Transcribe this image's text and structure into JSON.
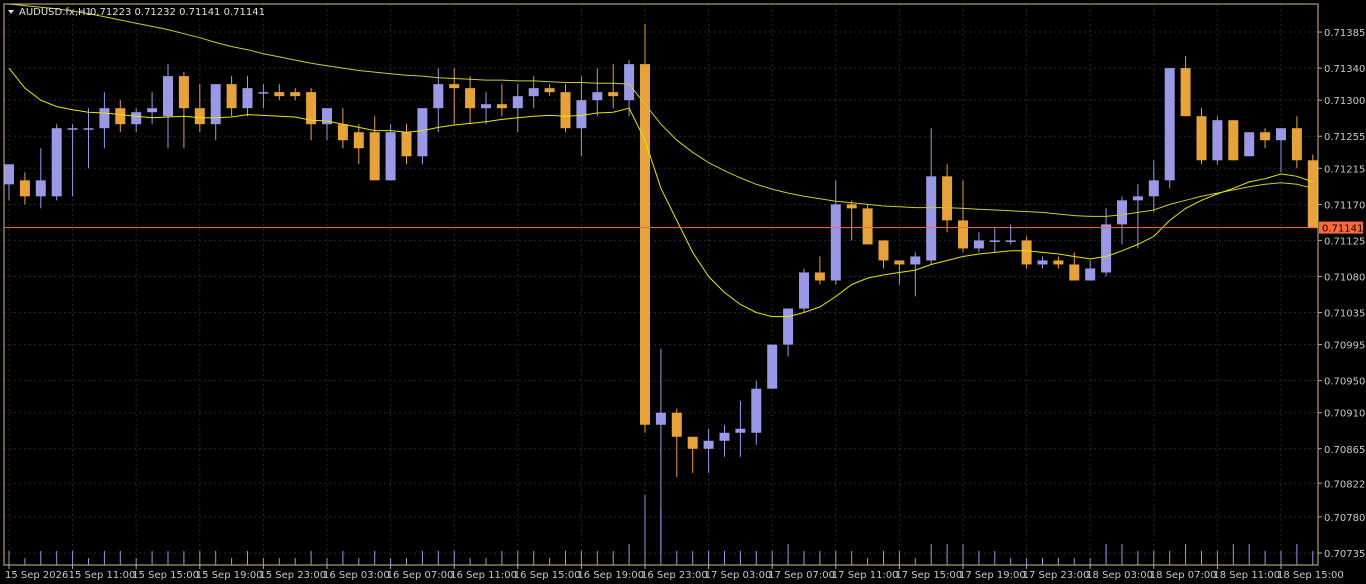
{
  "header": {
    "symbol": "AUDUSD.fx,H1",
    "ohlc": "0.71223 0.71232 0.71141 0.71141"
  },
  "price_tag": "0.71141",
  "colors": {
    "background": "#000000",
    "grid": "#2a2a2a",
    "bull": "#9999e6",
    "bear": "#e6a23c",
    "ma_fast": "#e6e600",
    "ma_slow": "#cccc33",
    "price_line": "#ff6a3d",
    "axis_text": "#c8c8c8"
  },
  "chart_data": {
    "type": "candlestick",
    "ylim": [
      0.7072,
      0.7142
    ],
    "grid": true,
    "y_ticks": [
      "0.71385",
      "0.71340",
      "0.71300",
      "0.71255",
      "0.71215",
      "0.71170",
      "0.71125",
      "0.71080",
      "0.71035",
      "0.70995",
      "0.70950",
      "0.70910",
      "0.70865",
      "0.70822",
      "0.70780",
      "0.70735"
    ],
    "x_ticks": [
      "15 Sep 2026",
      "15 Sep 11:00",
      "15 Sep 15:00",
      "15 Sep 19:00",
      "15 Sep 23:00",
      "16 Sep 03:00",
      "16 Sep 07:00",
      "16 Sep 11:00",
      "16 Sep 15:00",
      "16 Sep 19:00",
      "16 Sep 23:00",
      "17 Sep 03:00",
      "17 Sep 07:00",
      "17 Sep 11:00",
      "17 Sep 15:00",
      "17 Sep 19:00",
      "17 Sep 23:00",
      "18 Sep 03:00",
      "18 Sep 07:00",
      "18 Sep 11:00",
      "18 Sep 15:00"
    ],
    "current_price": 0.71141,
    "candles": [
      {
        "o": 0.71195,
        "h": 0.7122,
        "l": 0.71175,
        "c": 0.7122
      },
      {
        "o": 0.712,
        "h": 0.7121,
        "l": 0.7117,
        "c": 0.7118
      },
      {
        "o": 0.7118,
        "h": 0.7124,
        "l": 0.71165,
        "c": 0.712
      },
      {
        "o": 0.7118,
        "h": 0.7127,
        "l": 0.71175,
        "c": 0.71265
      },
      {
        "o": 0.71265,
        "h": 0.7127,
        "l": 0.7118,
        "c": 0.71265
      },
      {
        "o": 0.71265,
        "h": 0.7129,
        "l": 0.71215,
        "c": 0.71265
      },
      {
        "o": 0.71265,
        "h": 0.7131,
        "l": 0.7124,
        "c": 0.7129
      },
      {
        "o": 0.7129,
        "h": 0.713,
        "l": 0.7126,
        "c": 0.7127
      },
      {
        "o": 0.7127,
        "h": 0.7129,
        "l": 0.7126,
        "c": 0.71285
      },
      {
        "o": 0.71285,
        "h": 0.7131,
        "l": 0.7127,
        "c": 0.7129
      },
      {
        "o": 0.7128,
        "h": 0.71345,
        "l": 0.7124,
        "c": 0.7133
      },
      {
        "o": 0.7133,
        "h": 0.71335,
        "l": 0.7124,
        "c": 0.7129
      },
      {
        "o": 0.7129,
        "h": 0.7132,
        "l": 0.7126,
        "c": 0.7127
      },
      {
        "o": 0.7127,
        "h": 0.7132,
        "l": 0.7125,
        "c": 0.7132
      },
      {
        "o": 0.7132,
        "h": 0.7133,
        "l": 0.7128,
        "c": 0.7129
      },
      {
        "o": 0.7129,
        "h": 0.7133,
        "l": 0.7128,
        "c": 0.71315
      },
      {
        "o": 0.7131,
        "h": 0.7132,
        "l": 0.7129,
        "c": 0.7131
      },
      {
        "o": 0.7131,
        "h": 0.7132,
        "l": 0.713,
        "c": 0.71305
      },
      {
        "o": 0.7131,
        "h": 0.71315,
        "l": 0.713,
        "c": 0.71305
      },
      {
        "o": 0.7131,
        "h": 0.71315,
        "l": 0.7125,
        "c": 0.7127
      },
      {
        "o": 0.7127,
        "h": 0.7129,
        "l": 0.7125,
        "c": 0.7129
      },
      {
        "o": 0.7127,
        "h": 0.7129,
        "l": 0.7124,
        "c": 0.7125
      },
      {
        "o": 0.7126,
        "h": 0.7127,
        "l": 0.7122,
        "c": 0.7124
      },
      {
        "o": 0.7126,
        "h": 0.7128,
        "l": 0.712,
        "c": 0.712
      },
      {
        "o": 0.712,
        "h": 0.7127,
        "l": 0.712,
        "c": 0.7126
      },
      {
        "o": 0.7126,
        "h": 0.7127,
        "l": 0.7122,
        "c": 0.7123
      },
      {
        "o": 0.7123,
        "h": 0.7128,
        "l": 0.7122,
        "c": 0.7129
      },
      {
        "o": 0.7129,
        "h": 0.7134,
        "l": 0.7126,
        "c": 0.7132
      },
      {
        "o": 0.7132,
        "h": 0.7134,
        "l": 0.7127,
        "c": 0.71315
      },
      {
        "o": 0.71315,
        "h": 0.7133,
        "l": 0.7127,
        "c": 0.7129
      },
      {
        "o": 0.7129,
        "h": 0.7131,
        "l": 0.7127,
        "c": 0.71295
      },
      {
        "o": 0.71295,
        "h": 0.7132,
        "l": 0.7128,
        "c": 0.7129
      },
      {
        "o": 0.7129,
        "h": 0.7132,
        "l": 0.7126,
        "c": 0.71305
      },
      {
        "o": 0.71305,
        "h": 0.7133,
        "l": 0.7129,
        "c": 0.71315
      },
      {
        "o": 0.71315,
        "h": 0.7132,
        "l": 0.71305,
        "c": 0.7131
      },
      {
        "o": 0.7131,
        "h": 0.7132,
        "l": 0.7126,
        "c": 0.71265
      },
      {
        "o": 0.71265,
        "h": 0.7133,
        "l": 0.7123,
        "c": 0.713
      },
      {
        "o": 0.713,
        "h": 0.7134,
        "l": 0.7128,
        "c": 0.7131
      },
      {
        "o": 0.7131,
        "h": 0.71345,
        "l": 0.7129,
        "c": 0.71305
      },
      {
        "o": 0.713,
        "h": 0.7135,
        "l": 0.7128,
        "c": 0.71345
      },
      {
        "o": 0.71345,
        "h": 0.71395,
        "l": 0.70885,
        "c": 0.70895
      },
      {
        "o": 0.70895,
        "h": 0.7099,
        "l": 0.70735,
        "c": 0.7091
      },
      {
        "o": 0.7091,
        "h": 0.70915,
        "l": 0.7083,
        "c": 0.7088
      },
      {
        "o": 0.7088,
        "h": 0.7088,
        "l": 0.70835,
        "c": 0.70865
      },
      {
        "o": 0.70865,
        "h": 0.7089,
        "l": 0.70835,
        "c": 0.70875
      },
      {
        "o": 0.70875,
        "h": 0.70895,
        "l": 0.70855,
        "c": 0.70885
      },
      {
        "o": 0.70885,
        "h": 0.70925,
        "l": 0.70855,
        "c": 0.7089
      },
      {
        "o": 0.70885,
        "h": 0.7095,
        "l": 0.7087,
        "c": 0.7094
      },
      {
        "o": 0.7094,
        "h": 0.7099,
        "l": 0.7094,
        "c": 0.70995
      },
      {
        "o": 0.70995,
        "h": 0.7104,
        "l": 0.7098,
        "c": 0.7104
      },
      {
        "o": 0.7104,
        "h": 0.7109,
        "l": 0.71035,
        "c": 0.71085
      },
      {
        "o": 0.71085,
        "h": 0.71105,
        "l": 0.7107,
        "c": 0.71075
      },
      {
        "o": 0.71075,
        "h": 0.712,
        "l": 0.7107,
        "c": 0.7117
      },
      {
        "o": 0.7117,
        "h": 0.71175,
        "l": 0.71125,
        "c": 0.71165
      },
      {
        "o": 0.71165,
        "h": 0.7117,
        "l": 0.7112,
        "c": 0.7112
      },
      {
        "o": 0.71125,
        "h": 0.71125,
        "l": 0.7109,
        "c": 0.711
      },
      {
        "o": 0.711,
        "h": 0.711,
        "l": 0.7107,
        "c": 0.71095
      },
      {
        "o": 0.71095,
        "h": 0.7111,
        "l": 0.71055,
        "c": 0.71105
      },
      {
        "o": 0.711,
        "h": 0.71265,
        "l": 0.71095,
        "c": 0.71205
      },
      {
        "o": 0.71205,
        "h": 0.7122,
        "l": 0.71135,
        "c": 0.7115
      },
      {
        "o": 0.7115,
        "h": 0.712,
        "l": 0.7111,
        "c": 0.71115
      },
      {
        "o": 0.71115,
        "h": 0.71135,
        "l": 0.7111,
        "c": 0.71125
      },
      {
        "o": 0.71125,
        "h": 0.7114,
        "l": 0.7111,
        "c": 0.71125
      },
      {
        "o": 0.71125,
        "h": 0.71145,
        "l": 0.7112,
        "c": 0.71125
      },
      {
        "o": 0.71125,
        "h": 0.7113,
        "l": 0.7109,
        "c": 0.71095
      },
      {
        "o": 0.71095,
        "h": 0.71105,
        "l": 0.7109,
        "c": 0.711
      },
      {
        "o": 0.711,
        "h": 0.71105,
        "l": 0.7109,
        "c": 0.71095
      },
      {
        "o": 0.71095,
        "h": 0.7111,
        "l": 0.71075,
        "c": 0.71075
      },
      {
        "o": 0.71075,
        "h": 0.711,
        "l": 0.71075,
        "c": 0.7109
      },
      {
        "o": 0.71085,
        "h": 0.71165,
        "l": 0.7108,
        "c": 0.71145
      },
      {
        "o": 0.71145,
        "h": 0.7118,
        "l": 0.7112,
        "c": 0.71175
      },
      {
        "o": 0.71175,
        "h": 0.71195,
        "l": 0.71115,
        "c": 0.7118
      },
      {
        "o": 0.7118,
        "h": 0.71225,
        "l": 0.7116,
        "c": 0.712
      },
      {
        "o": 0.712,
        "h": 0.7134,
        "l": 0.7119,
        "c": 0.7134
      },
      {
        "o": 0.7134,
        "h": 0.71355,
        "l": 0.7128,
        "c": 0.7128
      },
      {
        "o": 0.7128,
        "h": 0.7129,
        "l": 0.7122,
        "c": 0.71225
      },
      {
        "o": 0.71225,
        "h": 0.7128,
        "l": 0.7122,
        "c": 0.71275
      },
      {
        "o": 0.71275,
        "h": 0.71275,
        "l": 0.71225,
        "c": 0.71225
      },
      {
        "o": 0.7123,
        "h": 0.7126,
        "l": 0.7123,
        "c": 0.7126
      },
      {
        "o": 0.7126,
        "h": 0.71265,
        "l": 0.7124,
        "c": 0.7125
      },
      {
        "o": 0.7125,
        "h": 0.71265,
        "l": 0.7121,
        "c": 0.71265
      },
      {
        "o": 0.71265,
        "h": 0.7128,
        "l": 0.71215,
        "c": 0.71225
      },
      {
        "o": 0.71225,
        "h": 0.71232,
        "l": 0.71141,
        "c": 0.71141
      }
    ],
    "ma_fast": [
      0.7134,
      0.71315,
      0.713,
      0.71292,
      0.71288,
      0.71285,
      0.71284,
      0.71282,
      0.7128,
      0.71278,
      0.71279,
      0.7128,
      0.71278,
      0.71278,
      0.71279,
      0.71282,
      0.71281,
      0.7128,
      0.71279,
      0.71275,
      0.71274,
      0.7127,
      0.71266,
      0.71262,
      0.71262,
      0.7126,
      0.71262,
      0.71266,
      0.71269,
      0.71271,
      0.71273,
      0.71276,
      0.71278,
      0.7128,
      0.71281,
      0.7128,
      0.71281,
      0.71284,
      0.71285,
      0.7129,
      0.7125,
      0.7119,
      0.7115,
      0.7111,
      0.7108,
      0.7106,
      0.71045,
      0.71035,
      0.7103,
      0.7103,
      0.71035,
      0.71042,
      0.71055,
      0.7107,
      0.71078,
      0.71082,
      0.71085,
      0.71088,
      0.71095,
      0.711,
      0.71105,
      0.71108,
      0.7111,
      0.71112,
      0.71112,
      0.7111,
      0.71108,
      0.71105,
      0.71102,
      0.71105,
      0.71112,
      0.7112,
      0.7113,
      0.7115,
      0.71165,
      0.71175,
      0.71183,
      0.7119,
      0.71198,
      0.71202,
      0.71208,
      0.71205,
      0.71198
    ],
    "ma_slow": [
      0.7142,
      0.71418,
      0.71416,
      0.71414,
      0.71411,
      0.71408,
      0.71404,
      0.714,
      0.71396,
      0.71392,
      0.71388,
      0.71383,
      0.71378,
      0.71372,
      0.71367,
      0.71363,
      0.71358,
      0.71354,
      0.7135,
      0.71346,
      0.71343,
      0.7134,
      0.71337,
      0.71335,
      0.71333,
      0.71331,
      0.7133,
      0.71328,
      0.71327,
      0.71326,
      0.71325,
      0.71325,
      0.71324,
      0.71324,
      0.71323,
      0.71322,
      0.71322,
      0.71321,
      0.71321,
      0.7132,
      0.71295,
      0.7127,
      0.7125,
      0.71235,
      0.71222,
      0.71212,
      0.71203,
      0.71195,
      0.71189,
      0.71184,
      0.7118,
      0.71177,
      0.71174,
      0.71172,
      0.7117,
      0.71168,
      0.71167,
      0.71166,
      0.71166,
      0.71166,
      0.71165,
      0.71164,
      0.71163,
      0.71162,
      0.71161,
      0.7116,
      0.71158,
      0.71156,
      0.71155,
      0.71155,
      0.71157,
      0.7116,
      0.71163,
      0.7117,
      0.71175,
      0.7118,
      0.71184,
      0.71188,
      0.71192,
      0.71195,
      0.71197,
      0.71195,
      0.7119
    ],
    "volume": [
      2,
      1,
      2,
      2,
      2,
      1,
      2,
      2,
      1,
      2,
      2,
      2,
      2,
      2,
      1,
      2,
      1,
      1,
      1,
      2,
      1,
      2,
      1,
      2,
      1,
      1,
      2,
      2,
      2,
      1,
      1,
      2,
      2,
      2,
      1,
      2,
      2,
      2,
      2,
      3,
      10,
      8,
      2,
      2,
      2,
      2,
      2,
      2,
      2,
      3,
      2,
      2,
      2,
      2,
      1,
      2,
      2,
      1,
      3,
      3,
      3,
      2,
      2,
      1,
      1,
      1,
      1,
      1,
      1,
      3,
      3,
      2,
      2,
      2,
      3,
      2,
      2,
      3,
      3,
      2,
      2,
      3,
      2
    ]
  }
}
